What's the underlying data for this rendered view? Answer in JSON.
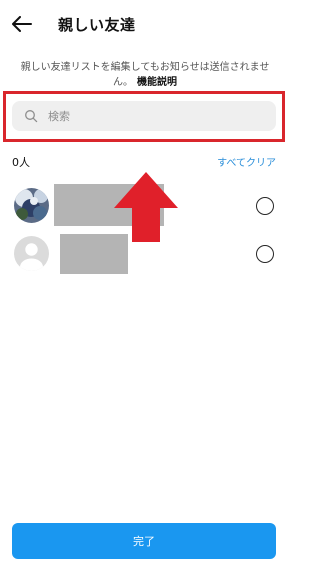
{
  "header": {
    "title": "親しい友達",
    "back_icon": "back-arrow-icon"
  },
  "description": {
    "text": "親しい友達リストを編集してもお知らせは送信されません。",
    "link_label": "機能説明"
  },
  "search": {
    "placeholder": "検索",
    "value": ""
  },
  "selection": {
    "count_label": "0人",
    "clear_all_label": "すべてクリア"
  },
  "list": {
    "items": [
      {
        "avatar": "photo-avatar",
        "name": "",
        "selected": false
      },
      {
        "avatar": "default-avatar",
        "name": "",
        "selected": false
      }
    ]
  },
  "annotation": {
    "frame_color": "#d9262c",
    "arrow_color": "#d9262c"
  },
  "footer": {
    "done_label": "完了"
  },
  "colors": {
    "accent": "#1a97f0",
    "link": "#2a8ed9"
  }
}
